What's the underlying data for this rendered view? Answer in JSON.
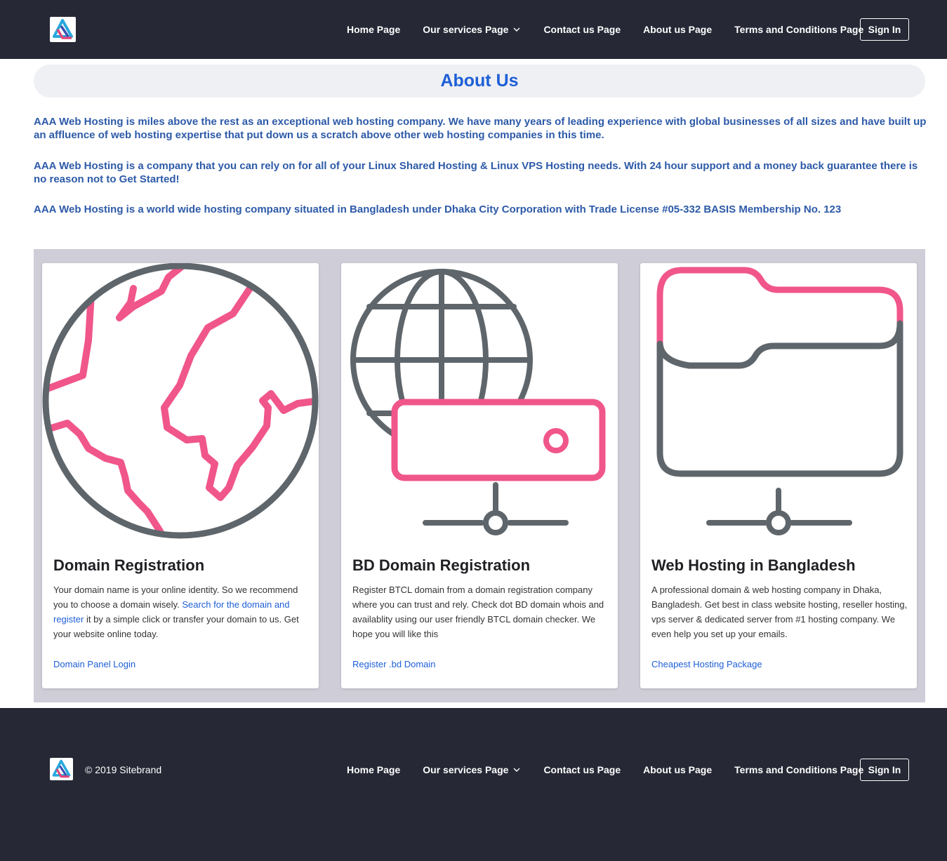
{
  "header": {
    "logo_icon": "brand-logo-icon",
    "nav": [
      {
        "label": "Home Page"
      },
      {
        "label": "Our services Page",
        "has_dropdown": true
      },
      {
        "label": "Contact us Page"
      },
      {
        "label": "About us Page"
      },
      {
        "label": "Terms and Conditions Page"
      }
    ],
    "signin_label": "Sign In"
  },
  "about": {
    "title": "About Us",
    "paragraphs": [
      "AAA Web Hosting is miles above the rest as an exceptional web hosting company. We have many years of leading experience with global businesses of all sizes and have built up an affluence of web hosting expertise that put down us a scratch above other web hosting companies in this time.",
      "AAA Web Hosting is a company that you can rely on for all of your Linux Shared Hosting & Linux VPS Hosting needs. With 24 hour support and a money back guarantee there is no reason not to Get Started!",
      "AAA Web Hosting is a world wide hosting company situated in Bangladesh under Dhaka City Corporation with Trade License #05-332 BASIS Membership No. 123"
    ]
  },
  "colors": {
    "header_bg": "#262835",
    "accent_blue": "#1e5fd6",
    "illustration_pink": "#f0568a",
    "illustration_gray": "#5f666b",
    "services_bg": "#cecdd8"
  },
  "cards": [
    {
      "icon": "globe-icon",
      "title": "Domain Registration",
      "text_before": "Your domain name is your online identity. So we recommend you to choose a domain wisely. ",
      "inline_link": "Search for the domain and register",
      "text_after": " it by a simple click or transfer your domain to us. Get your website online today.",
      "link": "Domain Panel Login"
    },
    {
      "icon": "globe-server-icon",
      "title": "BD Domain Registration",
      "text_before": "Register BTCL domain from a domain registration company where you can trust and rely. Check dot BD domain whois and availablity using our user friendly BTCL domain checker. We hope you will like this",
      "inline_link": "",
      "text_after": "",
      "link": "Register .bd Domain"
    },
    {
      "icon": "folder-network-icon",
      "title": "Web Hosting in Bangladesh",
      "text_before": "A professional domain & web hosting company in Dhaka, Bangladesh. Get best in class website hosting, reseller hosting, vps server & dedicated server from #1 hosting company. We even help you set up your emails.",
      "inline_link": "",
      "text_after": "",
      "link": "Cheapest Hosting Package"
    }
  ],
  "footer": {
    "copyright": "© 2019 Sitebrand",
    "nav": [
      {
        "label": "Home Page"
      },
      {
        "label": "Our services Page",
        "has_dropdown": true
      },
      {
        "label": "Contact us Page"
      },
      {
        "label": "About us Page"
      },
      {
        "label": "Terms and Conditions Page"
      }
    ],
    "signin_label": "Sign In"
  }
}
